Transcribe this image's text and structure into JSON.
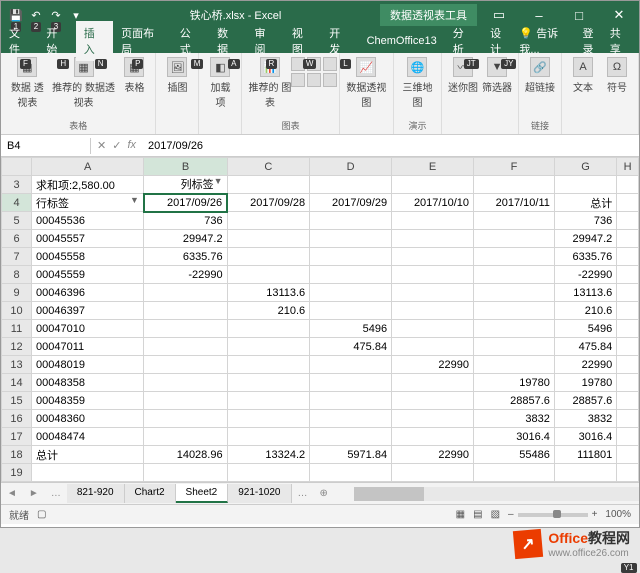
{
  "title": "铁心桥.xlsx - Excel",
  "tool_tab": "数据透视表工具",
  "menu": {
    "file": "文件",
    "home": "开始",
    "insert": "插入",
    "layout": "页面布局",
    "formula": "公式",
    "data": "数据",
    "review": "审阅",
    "view": "视图",
    "dev": "开发",
    "chem": "ChemOffice13",
    "analyze": "分析",
    "design": "设计",
    "tell": "告诉我...",
    "login": "登录",
    "share": "共享"
  },
  "keys": {
    "file": "F",
    "home": "H",
    "insert": "N",
    "layout": "P",
    "formula": "M",
    "data": "A",
    "review": "R",
    "view": "W",
    "dev": "L",
    "analyze": "JT",
    "design": "JY",
    "share": "Y1",
    "q1": "1",
    "q2": "2",
    "q3": "3"
  },
  "ribbon": {
    "g1": {
      "a": "数据\n透视表",
      "b": "推荐的\n数据透视表",
      "c": "表格",
      "label": "表格"
    },
    "g2": {
      "a": "插图",
      "label": ""
    },
    "g3": {
      "a": "加载\n项",
      "label": ""
    },
    "g4": {
      "a": "推荐的\n图表",
      "label": "图表"
    },
    "g5": {
      "a": "数据透视图",
      "label": ""
    },
    "g6": {
      "a": "三维地\n图",
      "label": "演示"
    },
    "g7": {
      "a": "迷你图",
      "b": "筛选器",
      "label": ""
    },
    "g8": {
      "a": "超链接",
      "label": "链接"
    },
    "g9": {
      "a": "文本",
      "b": "符号",
      "label": ""
    }
  },
  "namebox": "B4",
  "formula": "2017/09/26",
  "cols": [
    "",
    "A",
    "B",
    "C",
    "D",
    "E",
    "F",
    "G",
    "H"
  ],
  "rows": [
    {
      "n": "3",
      "c": [
        "求和项:2,580.00",
        "列标签",
        "",
        "",
        "",
        "",
        "",
        ""
      ],
      "drop": [
        false,
        true,
        false,
        false,
        false,
        false,
        false,
        false
      ]
    },
    {
      "n": "4",
      "c": [
        "行标签",
        "2017/09/26",
        "2017/09/28",
        "2017/09/29",
        "2017/10/10",
        "2017/10/11",
        "总计",
        ""
      ],
      "drop": [
        true,
        false,
        false,
        false,
        false,
        false,
        false,
        false
      ],
      "sel": 1
    },
    {
      "n": "5",
      "c": [
        "00045536",
        "736",
        "",
        "",
        "",
        "",
        "736",
        ""
      ]
    },
    {
      "n": "6",
      "c": [
        "00045557",
        "29947.2",
        "",
        "",
        "",
        "",
        "29947.2",
        ""
      ]
    },
    {
      "n": "7",
      "c": [
        "00045558",
        "6335.76",
        "",
        "",
        "",
        "",
        "6335.76",
        ""
      ]
    },
    {
      "n": "8",
      "c": [
        "00045559",
        "-22990",
        "",
        "",
        "",
        "",
        "-22990",
        ""
      ]
    },
    {
      "n": "9",
      "c": [
        "00046396",
        "",
        "13113.6",
        "",
        "",
        "",
        "13113.6",
        ""
      ]
    },
    {
      "n": "10",
      "c": [
        "00046397",
        "",
        "210.6",
        "",
        "",
        "",
        "210.6",
        ""
      ]
    },
    {
      "n": "11",
      "c": [
        "00047010",
        "",
        "",
        "5496",
        "",
        "",
        "5496",
        ""
      ]
    },
    {
      "n": "12",
      "c": [
        "00047011",
        "",
        "",
        "475.84",
        "",
        "",
        "475.84",
        ""
      ]
    },
    {
      "n": "13",
      "c": [
        "00048019",
        "",
        "",
        "",
        "22990",
        "",
        "22990",
        ""
      ]
    },
    {
      "n": "14",
      "c": [
        "00048358",
        "",
        "",
        "",
        "",
        "19780",
        "19780",
        ""
      ]
    },
    {
      "n": "15",
      "c": [
        "00048359",
        "",
        "",
        "",
        "",
        "28857.6",
        "28857.6",
        ""
      ]
    },
    {
      "n": "16",
      "c": [
        "00048360",
        "",
        "",
        "",
        "",
        "3832",
        "3832",
        ""
      ]
    },
    {
      "n": "17",
      "c": [
        "00048474",
        "",
        "",
        "",
        "",
        "3016.4",
        "3016.4",
        ""
      ]
    },
    {
      "n": "18",
      "c": [
        "总计",
        "14028.96",
        "13324.2",
        "5971.84",
        "22990",
        "55486",
        "111801",
        ""
      ]
    },
    {
      "n": "19",
      "c": [
        "",
        "",
        "",
        "",
        "",
        "",
        "",
        ""
      ]
    }
  ],
  "tabs": [
    "821-920",
    "Chart2",
    "Sheet2",
    "921-1020"
  ],
  "active_tab": 2,
  "status": "就绪",
  "zoom": "100%",
  "watermark": {
    "brand1": "Office",
    "brand2": "教程网",
    "url": "www.office26.com"
  }
}
